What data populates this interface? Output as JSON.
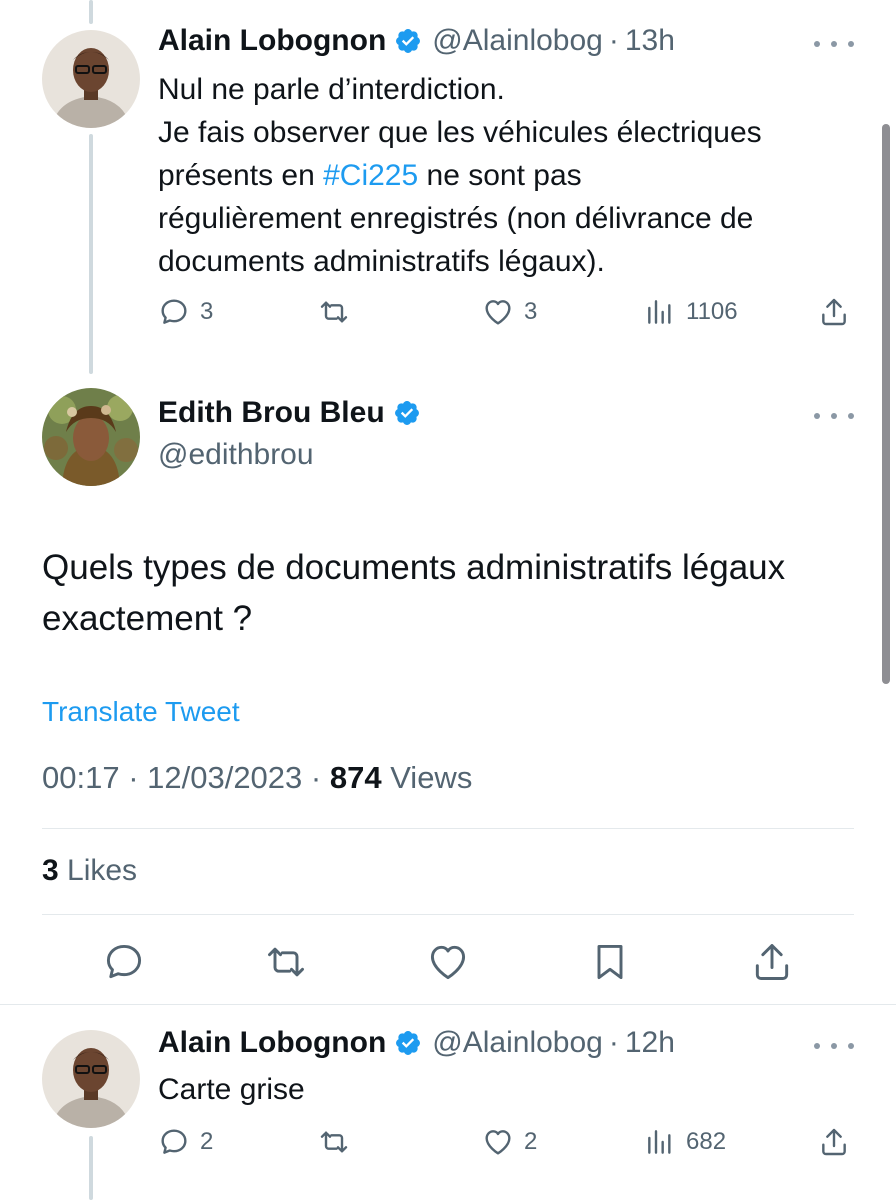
{
  "tweet1": {
    "author_name": "Alain Lobognon",
    "handle": "@Alainlobog",
    "time": "13h",
    "text_line1": "Nul ne parle d’interdiction.",
    "text_line2": "Je fais observer que les véhicules électriques",
    "text_line3_pre": "présents en ",
    "text_line3_hashtag": "#Ci225",
    "text_line3_post": " ne sont pas",
    "text_line4": "régulièrement enregistrés (non délivrance de",
    "text_line5": "documents administratifs légaux).",
    "replies": "3",
    "likes": "3",
    "views": "1106"
  },
  "main_tweet": {
    "author_name": "Edith Brou Bleu",
    "handle": "@edithbrou",
    "text_line1": "Quels types de documents administratifs légaux",
    "text_line2": "exactement ?",
    "translate_label": "Translate Tweet",
    "timestamp": "00:17 · 12/03/2023",
    "separator": " · ",
    "views_count": "874",
    "views_label": " Views",
    "likes_count": "3",
    "likes_label": " Likes"
  },
  "tweet2": {
    "author_name": "Alain Lobognon",
    "handle": "@Alainlobog",
    "time": "12h",
    "text": "Carte grise",
    "replies": "2",
    "likes": "2",
    "views": "682"
  },
  "dot": "·",
  "colors": {
    "accent": "#1d9bf0",
    "text": "#0f1419",
    "secondary": "#536471",
    "border": "#e4e9ec"
  },
  "icons": [
    "verified-badge-icon",
    "more-icon",
    "reply-icon",
    "retweet-icon",
    "like-icon",
    "views-icon",
    "share-icon",
    "bookmark-icon"
  ]
}
